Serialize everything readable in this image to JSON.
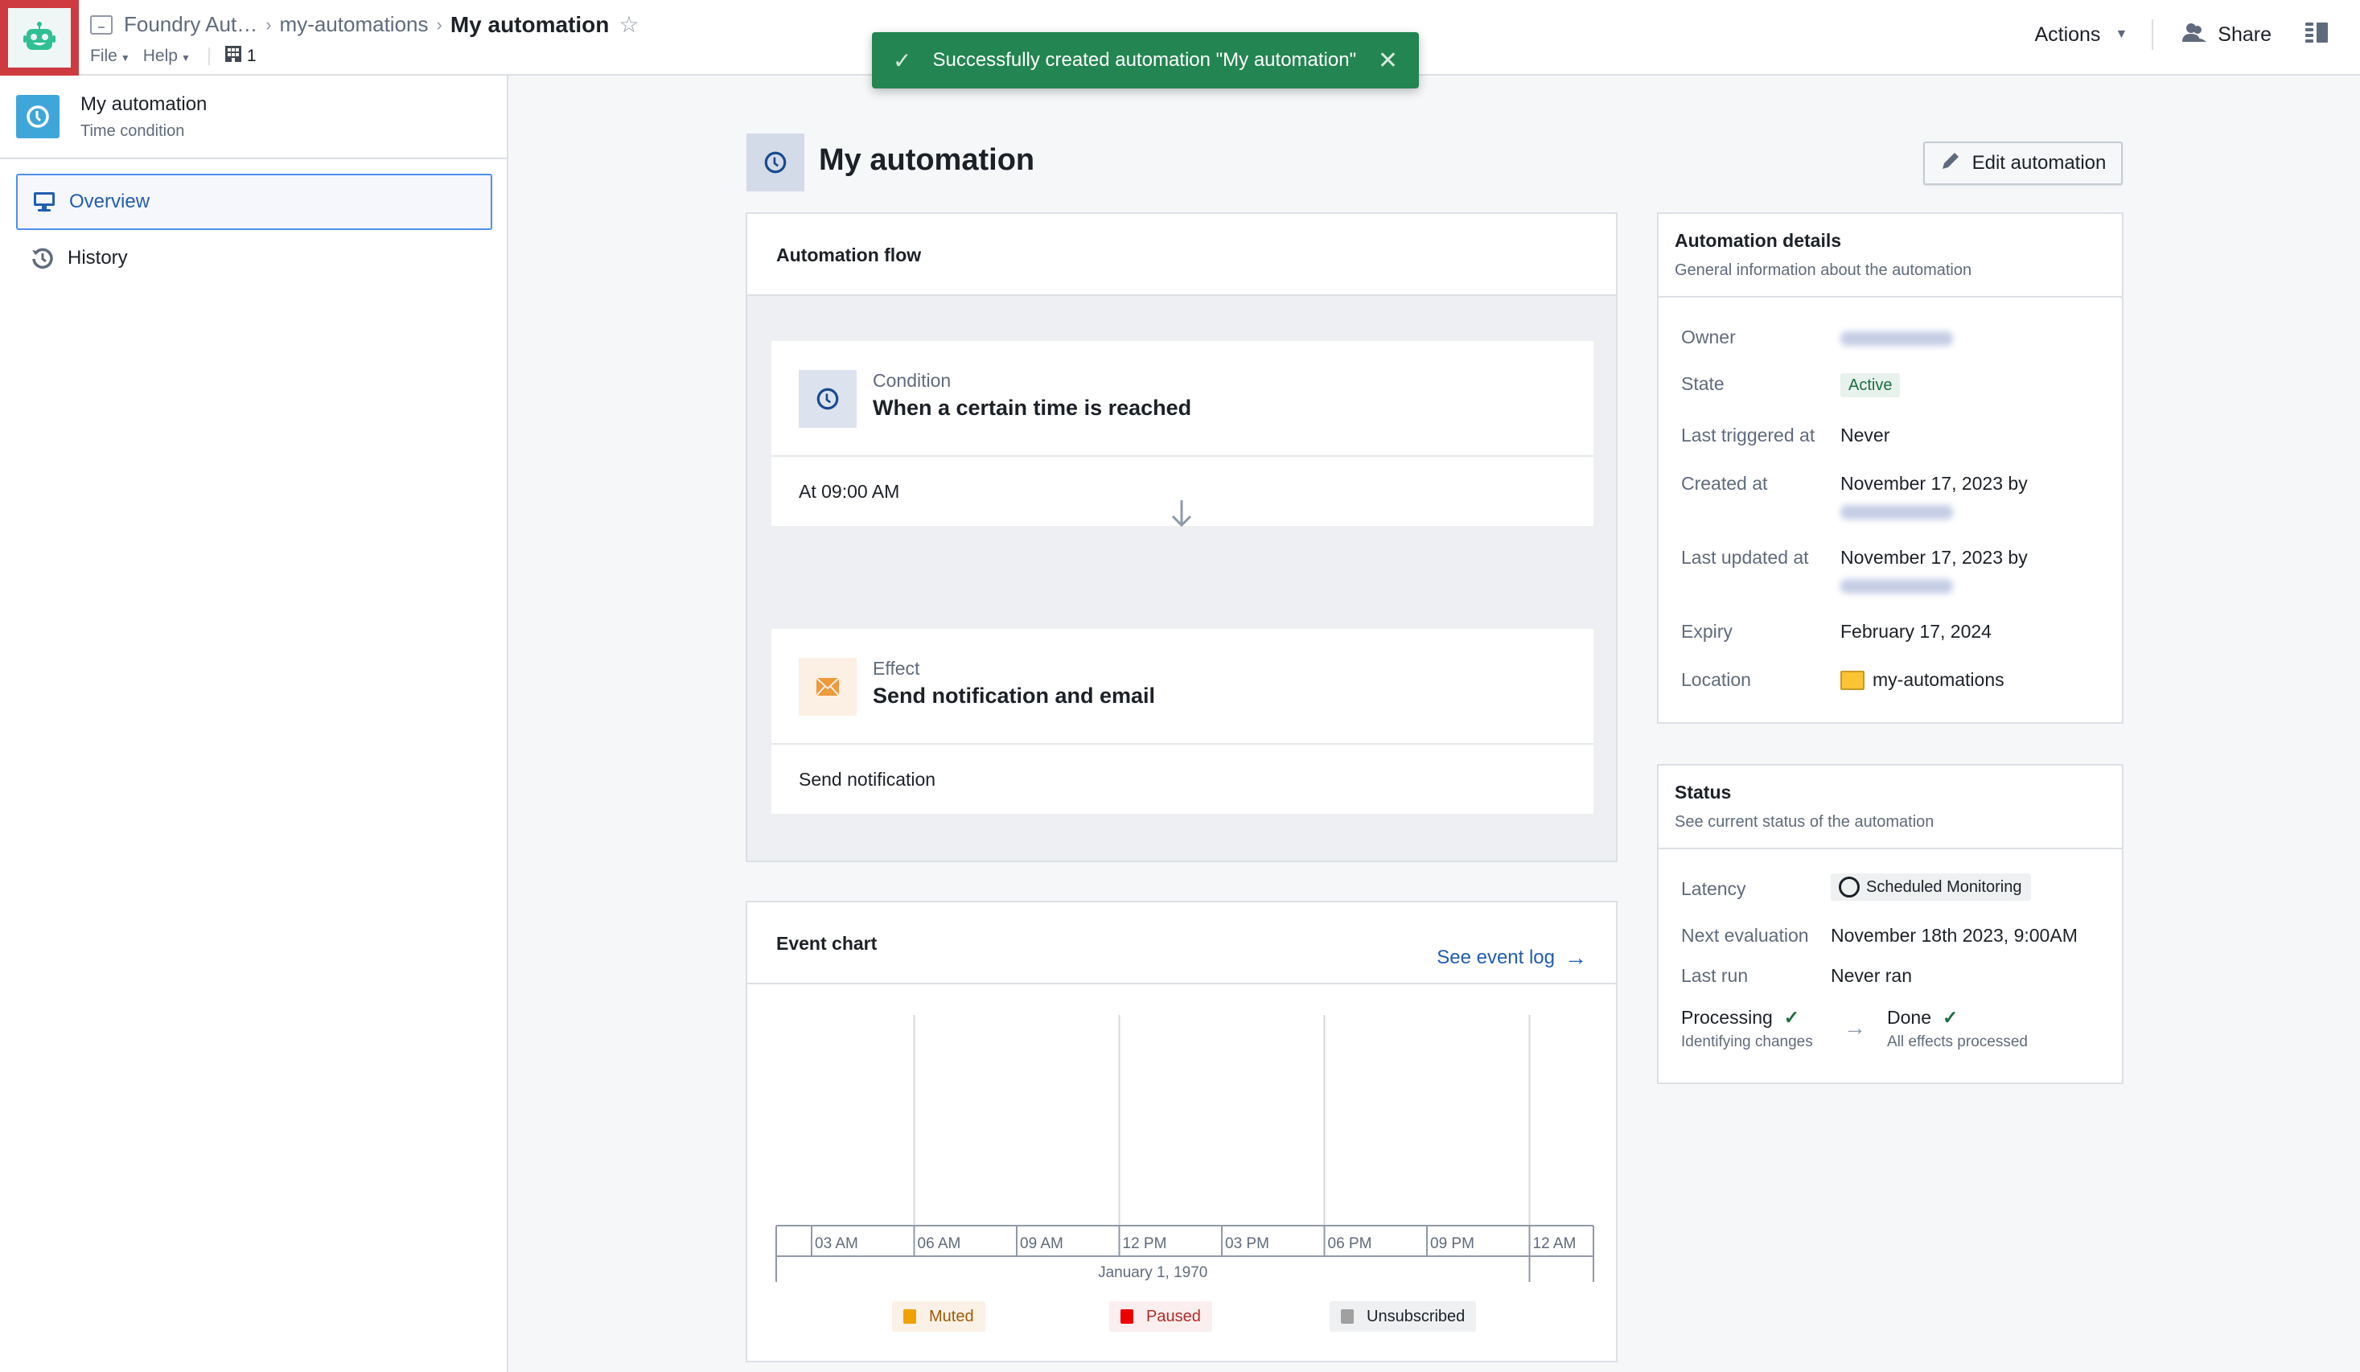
{
  "topbar": {
    "app_icon": "robot-icon",
    "breadcrumbs": [
      {
        "label": "Foundry Aut…",
        "icon": "compass-folder-icon"
      },
      {
        "label": "my-automations"
      },
      {
        "label": "My automation"
      }
    ],
    "menus": [
      "File",
      "Help"
    ],
    "building_count": "1",
    "actions_label": "Actions",
    "share_label": "Share"
  },
  "toast": {
    "message": "Successfully created automation \"My automation\"",
    "color": "#238551"
  },
  "sidebar": {
    "title": "My automation",
    "subtitle": "Time condition",
    "items": [
      {
        "label": "Overview",
        "icon": "desktop-icon",
        "active": true
      },
      {
        "label": "History",
        "icon": "history-icon",
        "active": false
      }
    ]
  },
  "main": {
    "title": "My automation",
    "edit_label": "Edit automation",
    "flow": {
      "title": "Automation flow",
      "condition": {
        "kind": "Condition",
        "title": "When a certain time is reached",
        "detail": "At 09:00 AM"
      },
      "effect": {
        "kind": "Effect",
        "title": "Send notification and email",
        "detail": "Send notification"
      }
    },
    "event_chart": {
      "title": "Event chart",
      "link_label": "See event log"
    }
  },
  "details": {
    "title": "Automation details",
    "subtitle": "General information about the automation",
    "rows": [
      {
        "label": "Owner",
        "value": ""
      },
      {
        "label": "State",
        "value": "Active"
      },
      {
        "label": "Last triggered at",
        "value": "Never"
      },
      {
        "label": "Created at",
        "value": "November 17, 2023 by"
      },
      {
        "label": "Last updated at",
        "value": "November 17, 2023 by"
      },
      {
        "label": "Expiry",
        "value": "February 17, 2024"
      },
      {
        "label": "Location",
        "value": "my-automations"
      }
    ]
  },
  "status": {
    "title": "Status",
    "subtitle": "See current status of the automation",
    "latency_label": "Latency",
    "latency_value": "Scheduled Monitoring",
    "next_eval_label": "Next evaluation",
    "next_eval_value": "November 18th 2023, 9:00AM",
    "last_run_label": "Last run",
    "last_run_value": "Never ran",
    "steps": [
      {
        "title": "Processing",
        "subtitle": "Identifying changes"
      },
      {
        "title": "Done",
        "subtitle": "All effects processed"
      }
    ]
  },
  "chart_data": {
    "type": "bar",
    "title": "Event chart",
    "xlabel": "January 1, 1970",
    "ylabel": "",
    "x_ticks": [
      "03 AM",
      "06 AM",
      "09 AM",
      "12 PM",
      "03 PM",
      "06 PM",
      "09 PM",
      "12 AM"
    ],
    "series": [
      {
        "name": "Muted",
        "color": "#f0a200",
        "values": []
      },
      {
        "name": "Paused",
        "color": "#ee0000",
        "values": []
      },
      {
        "name": "Unsubscribed",
        "color": "#a0a0a0",
        "values": []
      }
    ],
    "grid": true,
    "legend": "bottom"
  }
}
